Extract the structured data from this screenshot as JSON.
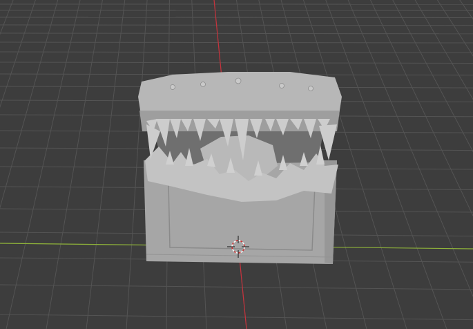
{
  "viewport": {
    "background_color": "#3d3d3d",
    "grid_color": "#545454",
    "x_axis_color": "#8fb33a",
    "y_axis_color": "#c8323c",
    "model_color": "#a9a9a9",
    "icons": [
      "3d-cursor-icon"
    ]
  }
}
